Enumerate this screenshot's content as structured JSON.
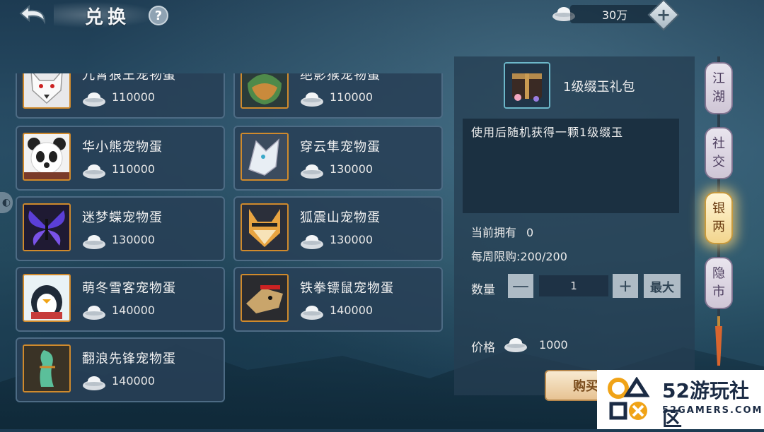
{
  "header": {
    "title": "兑换",
    "help_label": "?",
    "currency_value": "30万",
    "add_label": "+"
  },
  "items": [
    {
      "name": "九霄狼王宠物蛋",
      "price": "110000",
      "icon": "white-wolf"
    },
    {
      "name": "绝影猴宠物蛋",
      "price": "110000",
      "icon": "green-monkey"
    },
    {
      "name": "华小熊宠物蛋",
      "price": "110000",
      "icon": "panda"
    },
    {
      "name": "穿云隼宠物蛋",
      "price": "130000",
      "icon": "white-falcon"
    },
    {
      "name": "迷梦蝶宠物蛋",
      "price": "130000",
      "icon": "purple-butterfly"
    },
    {
      "name": "狐震山宠物蛋",
      "price": "130000",
      "icon": "fox"
    },
    {
      "name": "萌冬雪客宠物蛋",
      "price": "140000",
      "icon": "penguin"
    },
    {
      "name": "铁拳镖鼠宠物蛋",
      "price": "140000",
      "icon": "armored-rat"
    },
    {
      "name": "翻浪先锋宠物蛋",
      "price": "140000",
      "icon": "seahorse"
    }
  ],
  "detail": {
    "item_name": "1级缀玉礼包",
    "description": "使用后随机获得一颗1级缀玉",
    "owned_label": "当前拥有",
    "owned_value": "0",
    "weekly_label": "每周限购:",
    "weekly_value": "200/200",
    "qty_label": "数量",
    "minus_label": "—",
    "qty_value": "1",
    "plus_label": "+",
    "max_label": "最大",
    "price_label": "价格",
    "price_value": "1000",
    "buy_label": "购买"
  },
  "tabs": [
    {
      "line1": "江",
      "line2": "湖",
      "active": false
    },
    {
      "line1": "社",
      "line2": "交",
      "active": false
    },
    {
      "line1": "银",
      "line2": "两",
      "active": true
    },
    {
      "line1": "隐",
      "line2": "市",
      "active": false
    }
  ],
  "watermark": {
    "brand": "52游玩社区",
    "sub": "52GAMERS.COM"
  },
  "colors": {
    "accent_gold": "#f2d58e",
    "item_border": "#d08a2c",
    "panel_bg": "#284056"
  }
}
